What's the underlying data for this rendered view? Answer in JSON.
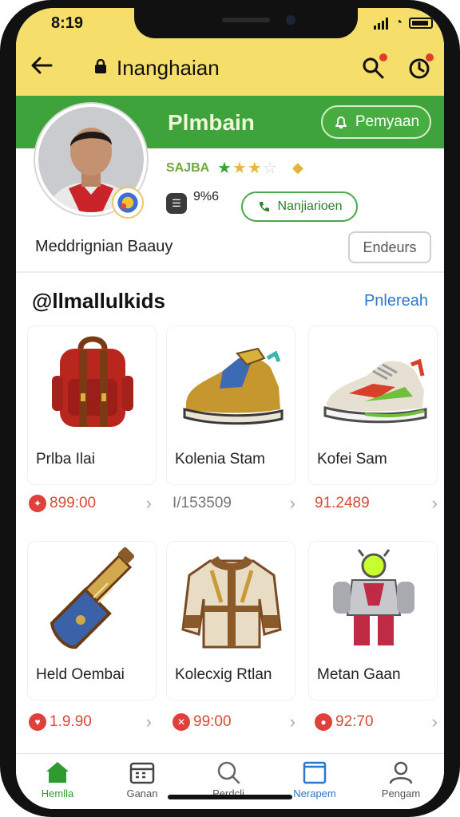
{
  "status": {
    "time": "8:19"
  },
  "nav": {
    "title": "Inanghaian"
  },
  "shop": {
    "name": "Plmbain",
    "follow_label": "Pemyaan",
    "rating_label": "SAJBA",
    "stars": "★★★☆",
    "phone_count": "9%6",
    "chat_label": "Nanjiarioen",
    "description": "Meddrignian Baauy",
    "details_label": "Endeurs"
  },
  "section": {
    "title": "@llmallulkids",
    "link": "Pnlereah"
  },
  "products": [
    {
      "name": "Prlba Ilai",
      "price": "899:00",
      "badge_icon": "tag-icon",
      "price_color": "#d84a36"
    },
    {
      "name": "Kolenia Stam",
      "price": "I/153509",
      "badge_icon": "",
      "price_color": "#777777"
    },
    {
      "name": "Kofei Sam",
      "price": "91.2489",
      "badge_icon": "",
      "price_color": "#d84a36"
    },
    {
      "name": "Held Oembai",
      "price": "1.9.90",
      "badge_icon": "heart-icon",
      "price_color": "#d84a36"
    },
    {
      "name": "Kolecxig Rtlan",
      "price": "99:00",
      "badge_icon": "close-icon",
      "price_color": "#d84a36"
    },
    {
      "name": "Metan Gaan",
      "price": "92:70",
      "badge_icon": "pin-icon",
      "price_color": "#d84a36"
    }
  ],
  "tabs": [
    {
      "label": "Hemlla",
      "icon": "home-icon"
    },
    {
      "label": "Ganan",
      "icon": "calendar-icon"
    },
    {
      "label": "Perdcli",
      "icon": "search-icon"
    },
    {
      "label": "Nerapem",
      "icon": "book-icon"
    },
    {
      "label": "Pengam",
      "icon": "profile-icon"
    }
  ],
  "colors": {
    "topbar": "#f6de6a",
    "brand_green": "#3ea33a",
    "accent_blue": "#2a78c9",
    "price_red": "#d84a36"
  }
}
